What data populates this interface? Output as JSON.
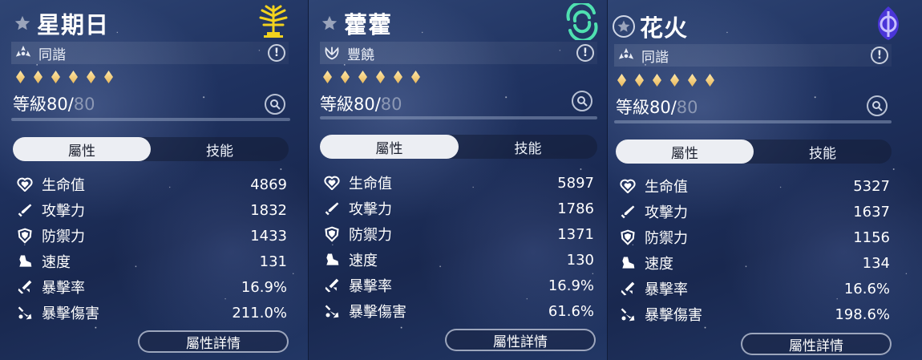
{
  "characters": [
    {
      "name": "星期日",
      "path": "同諧",
      "element_icon": "imaginary-element-icon",
      "path_icon": "harmony-path-icon",
      "level_label": "等級",
      "level": "80/",
      "level_max": "80",
      "tabs": [
        "屬性",
        "技能"
      ],
      "stats": [
        {
          "label": "生命值",
          "value": "4869",
          "icon": "hp-heart-icon"
        },
        {
          "label": "攻擊力",
          "value": "1832",
          "icon": "atk-sword-icon"
        },
        {
          "label": "防禦力",
          "value": "1433",
          "icon": "def-shield-icon"
        },
        {
          "label": "速度",
          "value": "131",
          "icon": "spd-boot-icon"
        },
        {
          "label": "暴擊率",
          "value": "16.9%",
          "icon": "crit-rate-icon"
        },
        {
          "label": "暴擊傷害",
          "value": "211.0%",
          "icon": "crit-dmg-icon"
        }
      ],
      "detail_button": "屬性詳情"
    },
    {
      "name": "藿藿",
      "path": "豐饒",
      "element_icon": "wind-element-icon",
      "path_icon": "abundance-path-icon",
      "level_label": "等級",
      "level": "80/",
      "level_max": "80",
      "tabs": [
        "屬性",
        "技能"
      ],
      "stats": [
        {
          "label": "生命值",
          "value": "5897",
          "icon": "hp-heart-icon"
        },
        {
          "label": "攻擊力",
          "value": "1786",
          "icon": "atk-sword-icon"
        },
        {
          "label": "防禦力",
          "value": "1371",
          "icon": "def-shield-icon"
        },
        {
          "label": "速度",
          "value": "130",
          "icon": "spd-boot-icon"
        },
        {
          "label": "暴擊率",
          "value": "16.9%",
          "icon": "crit-rate-icon"
        },
        {
          "label": "暴擊傷害",
          "value": "61.6%",
          "icon": "crit-dmg-icon"
        }
      ],
      "detail_button": "屬性詳情"
    },
    {
      "name": "花火",
      "path": "同諧",
      "element_icon": "quantum-element-icon",
      "path_icon": "harmony-path-icon",
      "level_label": "等級",
      "level": "80/",
      "level_max": "80",
      "tabs": [
        "屬性",
        "技能"
      ],
      "stats": [
        {
          "label": "生命值",
          "value": "5327",
          "icon": "hp-heart-icon"
        },
        {
          "label": "攻擊力",
          "value": "1637",
          "icon": "atk-sword-icon"
        },
        {
          "label": "防禦力",
          "value": "1156",
          "icon": "def-shield-icon"
        },
        {
          "label": "速度",
          "value": "134",
          "icon": "spd-boot-icon"
        },
        {
          "label": "暴擊率",
          "value": "16.6%",
          "icon": "crit-rate-icon"
        },
        {
          "label": "暴擊傷害",
          "value": "198.6%",
          "icon": "crit-dmg-icon"
        }
      ],
      "detail_button": "屬性詳情"
    }
  ],
  "colors": {
    "star_gold": "#e8b85c",
    "imaginary": "#f2d21e",
    "wind": "#4fe0b0",
    "quantum": "#6a5cf0",
    "tab_active_bg": "#eceef3"
  }
}
